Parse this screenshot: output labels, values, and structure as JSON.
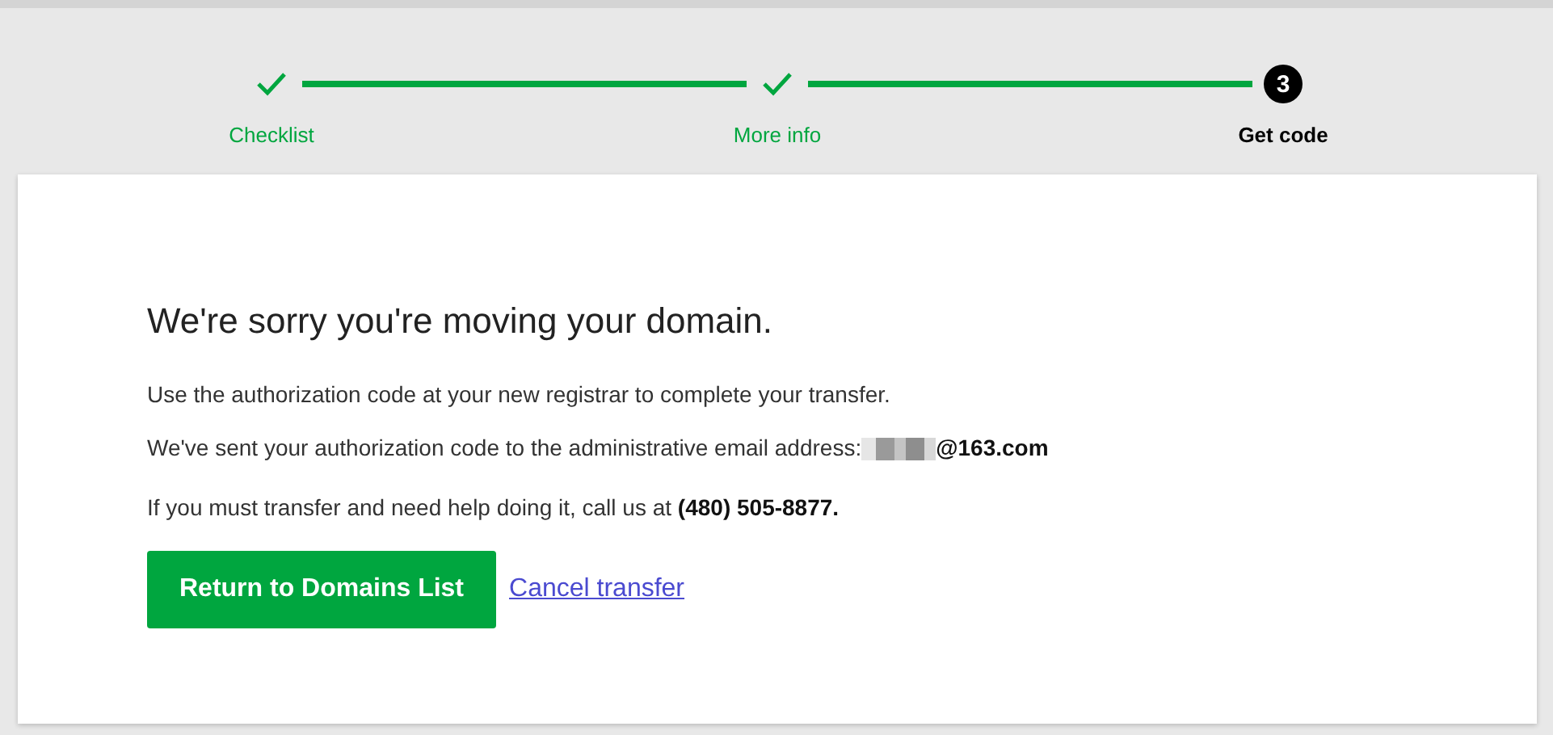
{
  "steps": [
    {
      "label": "Checklist",
      "completed": true
    },
    {
      "label": "More info",
      "completed": true
    },
    {
      "label": "Get code",
      "completed": false,
      "number": "3"
    }
  ],
  "title": "We're sorry you're moving your domain.",
  "instruction": "Use the authorization code at your new registrar to complete your transfer.",
  "email_notice": {
    "text": "We've sent your authorization code to the administrative email address:",
    "redacted": true,
    "email": "@163.com"
  },
  "help": "If you must transfer and need help doing it, call us at **(480) 505-8877.**",
  "primary_button": "Return to Domains List",
  "cancel_link": "Cancel transfer"
}
